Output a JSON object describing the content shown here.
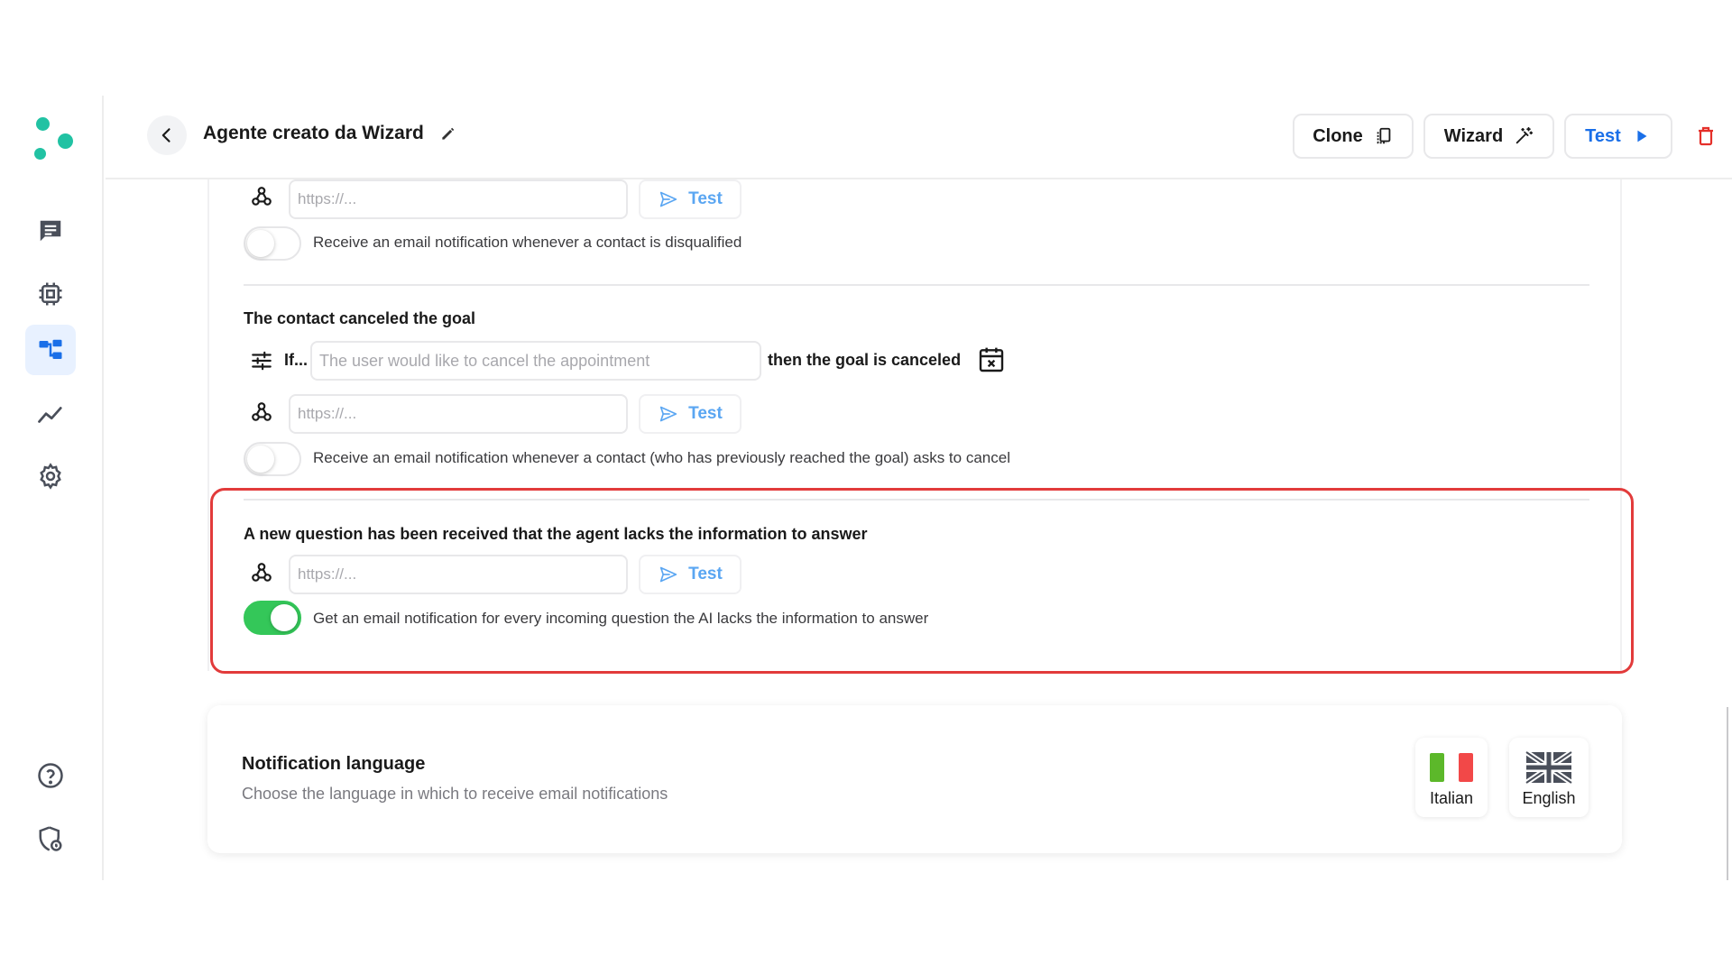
{
  "header": {
    "title": "Agente creato da Wizard",
    "clone_label": "Clone",
    "wizard_label": "Wizard",
    "test_label": "Test"
  },
  "sidebar": {
    "items": [
      {
        "icon": "chat-icon"
      },
      {
        "icon": "chip-icon"
      },
      {
        "icon": "workflow-icon",
        "active": true
      },
      {
        "icon": "analytics-icon"
      },
      {
        "icon": "gear-icon"
      },
      {
        "icon": "help-icon"
      },
      {
        "icon": "security-icon"
      }
    ]
  },
  "disqualified": {
    "url_placeholder": "https://...",
    "test_label": "Test",
    "toggle_label": "Receive an email notification whenever a contact is disqualified",
    "toggle_on": false
  },
  "canceled": {
    "title": "The contact canceled the goal",
    "if_label": "If...",
    "condition_placeholder": "The user would like to cancel the appointment",
    "then_label": "then the goal is canceled",
    "url_placeholder": "https://...",
    "test_label": "Test",
    "toggle_label": "Receive an email notification whenever a contact (who has previously reached the goal) asks to cancel",
    "toggle_on": false
  },
  "new_question": {
    "title": "A new question has been received that the agent lacks the information to answer",
    "url_placeholder": "https://...",
    "test_label": "Test",
    "toggle_label": "Get an email notification for every incoming question the AI lacks the information to answer",
    "toggle_on": true
  },
  "language": {
    "title": "Notification language",
    "subtitle": "Choose the language in which to receive email notifications",
    "options": [
      {
        "label": "Italian",
        "icon": "italy-flag-icon"
      },
      {
        "label": "English",
        "icon": "uk-flag-icon"
      }
    ]
  },
  "colors": {
    "accent": "#1a6fe8",
    "brand": "#21c2a3",
    "toggle_on": "#34c759",
    "highlight": "#e23b3b",
    "delete": "#e5302a"
  }
}
